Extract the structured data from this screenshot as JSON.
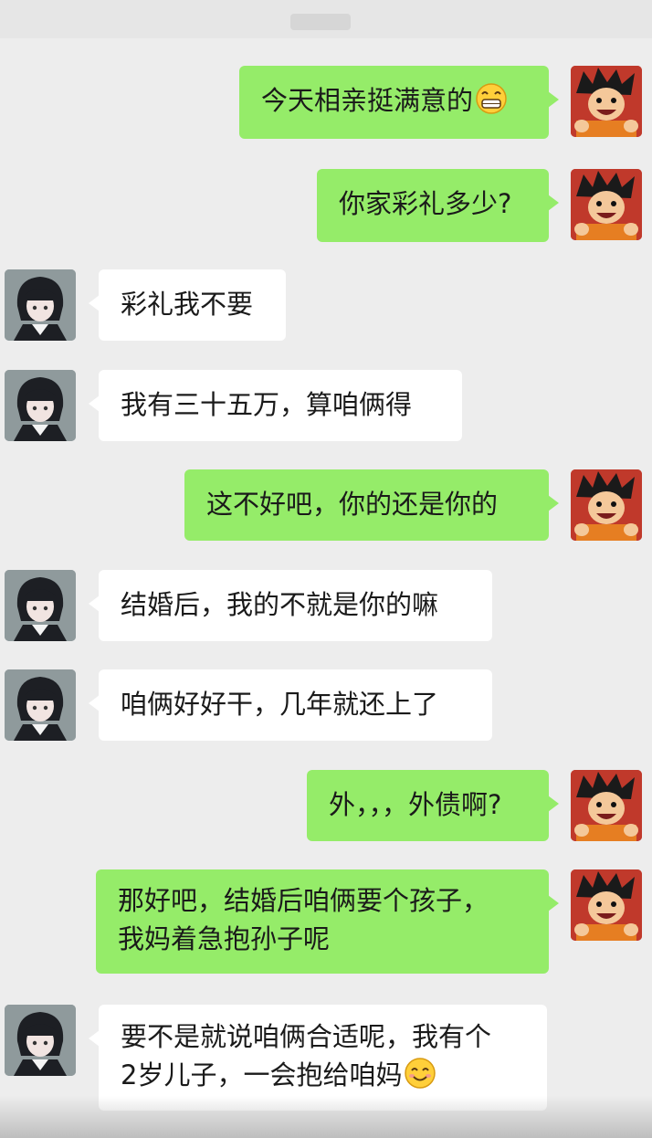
{
  "messages": [
    {
      "side": "me",
      "text": "今天相亲挺满意的",
      "emoji": "grin-emoji"
    },
    {
      "side": "me",
      "text": "你家彩礼多少?"
    },
    {
      "side": "her",
      "text": "彩礼我不要"
    },
    {
      "side": "her",
      "text": "我有三十五万，算咱俩得"
    },
    {
      "side": "me",
      "text": "这不好吧，你的还是你的"
    },
    {
      "side": "her",
      "text": "结婚后，我的不就是你的嘛"
    },
    {
      "side": "her",
      "text": "咱俩好好干，几年就还上了"
    },
    {
      "side": "me",
      "text": "外，，，外债啊?"
    },
    {
      "side": "me",
      "line1": "那好吧，结婚后咱俩要个孩子，",
      "line2": "我妈着急抱孙子呢"
    },
    {
      "side": "her",
      "line1": "要不是就说咱俩合适呢，我有个",
      "line2": "2岁儿子，一会抱给咱妈",
      "emoji": "smile-emoji"
    }
  ],
  "colors": {
    "my_bubble": "#95ec69",
    "their_bubble": "#ffffff",
    "background": "#ededed"
  },
  "avatars": {
    "me": "cartoon-boy-avatar",
    "her": "anime-girl-avatar"
  }
}
